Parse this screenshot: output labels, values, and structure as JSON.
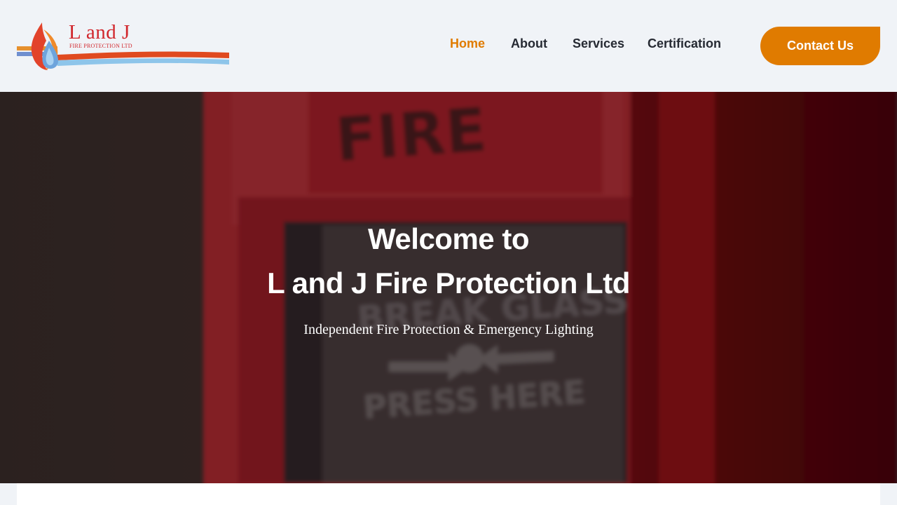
{
  "logo": {
    "title": "L and J",
    "subtitle": "FIRE PROTECTION LTD",
    "icon": "flame-droplet-icon"
  },
  "nav": {
    "items": [
      {
        "label": "Home",
        "active": true
      },
      {
        "label": "About",
        "active": false
      },
      {
        "label": "Services",
        "active": false
      },
      {
        "label": "Certification",
        "active": false
      }
    ],
    "cta_label": "Contact Us"
  },
  "hero": {
    "line1": "Welcome to",
    "line2": "L and J Fire Protection Ltd",
    "tagline": "Independent Fire Protection & Emergency Lighting",
    "image_sign_top": "FIRE",
    "image_sign_middle": "BREAK GLASS",
    "image_sign_bottom": "PRESS HERE"
  },
  "colors": {
    "accent": "#e07b00",
    "brand_red": "#d1262c",
    "header_bg": "#f0f3f7",
    "nav_text": "#262a33"
  }
}
